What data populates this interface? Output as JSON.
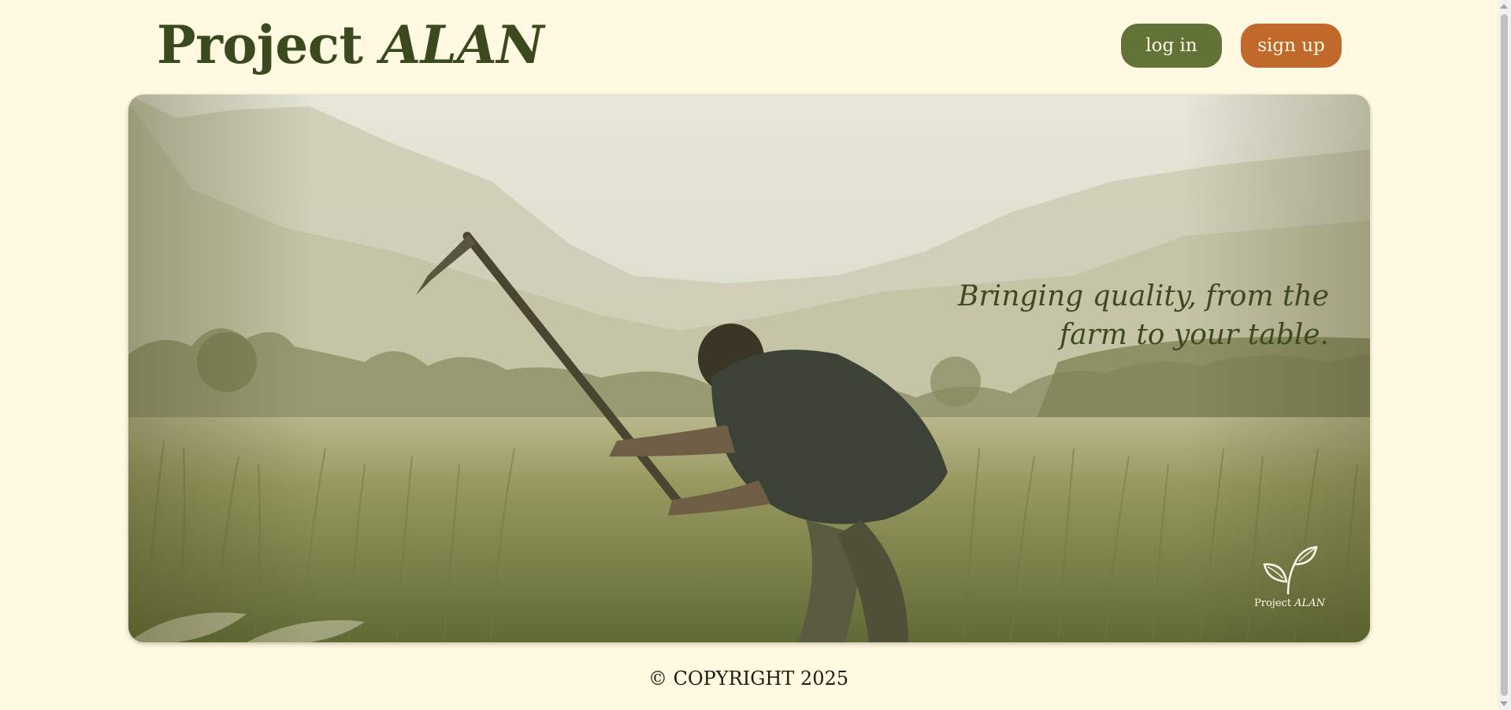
{
  "header": {
    "brand_main": "Project ",
    "brand_em": "ALAN",
    "login_label": "log in",
    "signup_label": "sign up"
  },
  "hero": {
    "tagline_line1": "Bringing quality, from the",
    "tagline_line2": "farm to your table.",
    "logo_main": "Project ",
    "logo_em": "ALAN",
    "image_description_icon": "farmer-photo"
  },
  "footer": {
    "copyright": "© COPYRIGHT 2025"
  },
  "colors": {
    "background": "#fef9e0",
    "brand_text": "#3b4a1e",
    "login_button": "#627337",
    "signup_button": "#c1692a",
    "tagline": "#3d4a20"
  }
}
